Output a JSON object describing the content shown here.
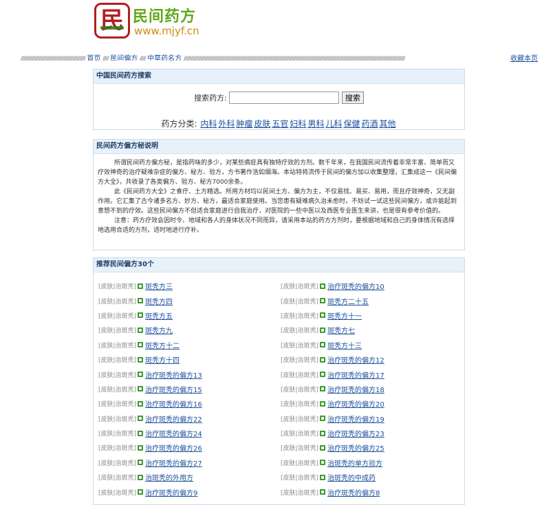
{
  "header": {
    "logo_char": "民",
    "site_name": "民间药方",
    "site_url": "www.mjyf.cn"
  },
  "nav": {
    "slashes_left": "//////////////////////////////////////////////",
    "home": "首页",
    "sep1": "////",
    "folk": "民间偏方",
    "sep2": "////",
    "herbal": "中草药名方",
    "slashes_right": "//////////////////////////////////////////////////////////////////////////////////////////////////////////////////////////////////////////////////////////////",
    "bookmark": "收藏本页"
  },
  "search": {
    "title": "中国民间药方搜索",
    "label": "搜索药方:",
    "input_value": "",
    "button": "搜索",
    "cat_label": "药方分类:",
    "categories": [
      "内科",
      "外科",
      "肿瘤",
      "皮肤",
      "五官",
      "妇科",
      "男科",
      "儿科",
      "保健",
      "药酒",
      "其他"
    ]
  },
  "intro": {
    "title": "民间药方偏方秘说明",
    "p1": "所谓民间药方偏方秘，是指药味的多少，对某些病症具有独特疗效的方剂。数千年来，在我国民间流传着非常丰富、简单而又疗效神奇的治疗疑难杂症的偏方、秘方、验方，方书著作浩如烟海。本站特将流传于民间的偏方加以收集整理，汇集成这一《民间偏方大全》，共收录了各类偏方、验方、秘方7000余条。",
    "p2": "此《民间药方大全》之食疗、土方精选。所用方材均以民间土方、偏方为主，不仅易找、易买、易用，而且疗效神奇，又无副作用。它汇集了古今诸多名方、妙方、秘方，最适合家庭使用。当您患有疑难病久治未愈时，不妨试一试这些民间偏方，或许能起到意想不到的疗效。这些民间偏方不但适合家庭进行自我治疗，对医院的一些中医以及西医专业医生来讲，也是很有参考价值的。",
    "p3": "注意：药方疗效会因时令、地域和各人的身体状况不同而异，请采用本站的药方方剂时，要根据地域和自己的身体情况有选择地选用合适的方剂，适时地进行疗补。"
  },
  "recommend": {
    "title": "推荐民间偏方30个",
    "tag": "[皮肤|治斑秃]",
    "items": [
      [
        "斑秃方三",
        "治疗斑秃的偏方10"
      ],
      [
        "斑秃方四",
        "斑秃方二十五"
      ],
      [
        "斑秃方五",
        "斑秃方十一"
      ],
      [
        "斑秃方九",
        "斑秃方七"
      ],
      [
        "斑秃方十二",
        "斑秃方十三"
      ],
      [
        "斑秃方十四",
        "治疗斑秃的偏方12"
      ],
      [
        "治疗斑秃的偏方13",
        "治疗斑秃的偏方17"
      ],
      [
        "治疗斑秃的偏方15",
        "治疗斑秃的偏方18"
      ],
      [
        "治疗斑秃的偏方16",
        "治疗斑秃的偏方20"
      ],
      [
        "治疗斑秃的偏方22",
        "治疗斑秃的偏方19"
      ],
      [
        "治疗斑秃的偏方24",
        "治疗斑秃的偏方23"
      ],
      [
        "治疗斑秃的偏方26",
        "治疗斑秃的偏方25"
      ],
      [
        "治疗斑秃的偏方27",
        "治斑秃的单方验方"
      ],
      [
        "治斑秃的外用方",
        "治斑秃的中成药"
      ],
      [
        "治疗斑秃的偏方9",
        "治疗斑秃的偏方8"
      ]
    ]
  }
}
